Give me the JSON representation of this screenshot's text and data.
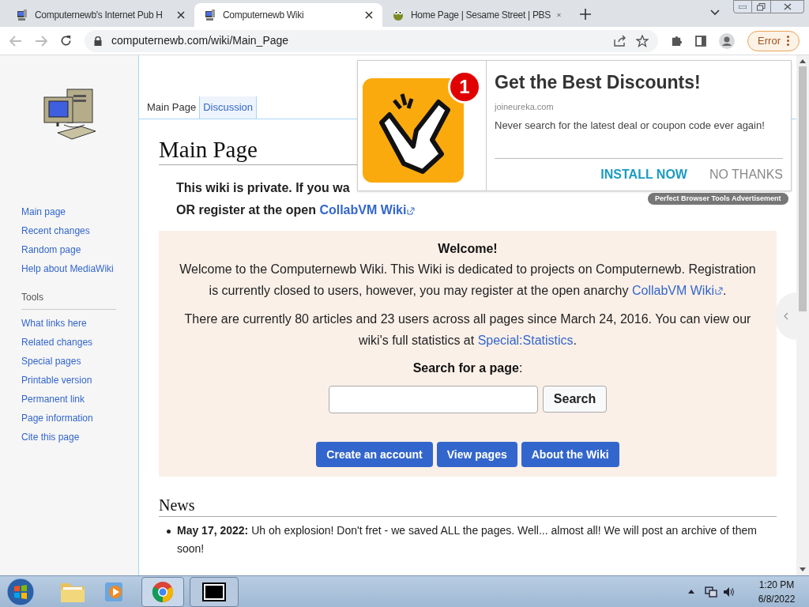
{
  "browser": {
    "tabs": [
      {
        "title": "Computernewb's Internet Pub H",
        "selected": false,
        "kind": "computer"
      },
      {
        "title": "Computernewb Wiki",
        "selected": true,
        "kind": "computer"
      },
      {
        "title": "Home Page | Sesame Street | PBS",
        "selected": false,
        "kind": "sesame"
      }
    ],
    "url": "computernewb.com/wiki/Main_Page",
    "error_button": "Error"
  },
  "sidebar": {
    "nav": [
      "Main page",
      "Recent changes",
      "Random page",
      "Help about MediaWiki"
    ],
    "tools_heading": "Tools",
    "tools": [
      "What links here",
      "Related changes",
      "Special pages",
      "Printable version",
      "Permanent link",
      "Page information",
      "Cite this page"
    ]
  },
  "page_tabs": [
    {
      "label": "Main Page",
      "selected": true
    },
    {
      "label": "Discussion",
      "selected": false
    }
  ],
  "title": "Main Page",
  "notice": {
    "line1": "This wiki is private. If you wa",
    "line2": "OR register at the open ",
    "link": "CollabVM Wiki"
  },
  "welcome": {
    "heading": "Welcome!",
    "para1": {
      "text": "Welcome to the Computernewb Wiki. This Wiki is dedicated to projects on Computernewb. Registration is currently closed to users, however, you may register at the open anarchy ",
      "link": "CollabVM Wiki",
      "after": "."
    },
    "para2": {
      "text": "There are currently 80 articles and 23 users across all pages since March 24, 2016. You can view our wiki's full statistics at ",
      "link": "Special:Statistics",
      "after": "."
    },
    "search_label": "**Search for a page**:",
    "search_button": "Search",
    "buttons": [
      "Create an account",
      "View pages",
      "About the Wiki"
    ]
  },
  "news": {
    "heading": "News",
    "items": [
      {
        "date": "May 17, 2022:",
        "text": "Uh oh explosion! Don't fret - we saved ALL the pages. Well... almost all! We will post an archive of them soon!"
      }
    ]
  },
  "ad": {
    "badge": "1",
    "title": "Get the Best Discounts!",
    "domain": "joineureka.com",
    "body": "Never search for the latest deal or coupon code ever again!",
    "install": "INSTALL NOW",
    "dismiss": "NO THANKS",
    "label": "Perfect Browser Tools Advertisement"
  },
  "taskbar": {
    "time": "1:20 PM",
    "date": "6/8/2022"
  }
}
